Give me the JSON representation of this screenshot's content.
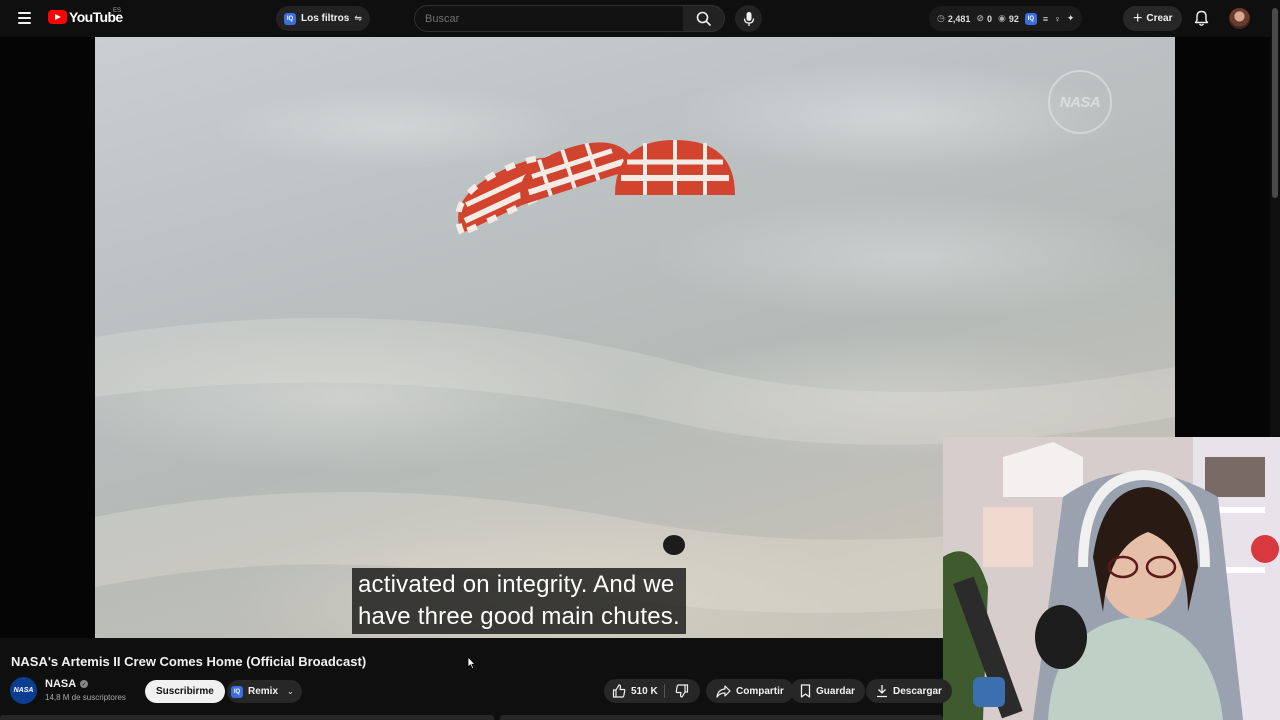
{
  "header": {
    "logo_text": "YouTube",
    "region": "ES",
    "filters_chip": {
      "badge": "IQ",
      "label": "Los filtros"
    },
    "search": {
      "placeholder": "Buscar",
      "value": ""
    },
    "stats": [
      {
        "icon": "clock-icon",
        "value": "2,481"
      },
      {
        "icon": "eye-off-icon",
        "value": "0"
      },
      {
        "icon": "eye-icon",
        "value": "92"
      }
    ],
    "extension_badge": "IQ",
    "create_label": "Crear"
  },
  "video": {
    "watermark": "NASA",
    "captions": [
      "activated on integrity. And we",
      "have three good main chutes."
    ],
    "title": "NASA's Artemis II Crew Comes Home (Official Broadcast)"
  },
  "channel": {
    "avatar_text": "NASA",
    "name": "NASA",
    "subscribers": "14,8 M de suscriptores",
    "subscribe_label": "Suscribirme",
    "remix_badge": "IQ",
    "remix_label": "Remix"
  },
  "actions": {
    "likes": "510 K",
    "share": "Compartir",
    "save": "Guardar",
    "download": "Descargar"
  },
  "colors": {
    "background": "#0f0f0f",
    "brand_red": "#ff0000",
    "chip": "#272727",
    "iq_blue": "#3b6fe0",
    "parachute_red": "#d2442e"
  }
}
